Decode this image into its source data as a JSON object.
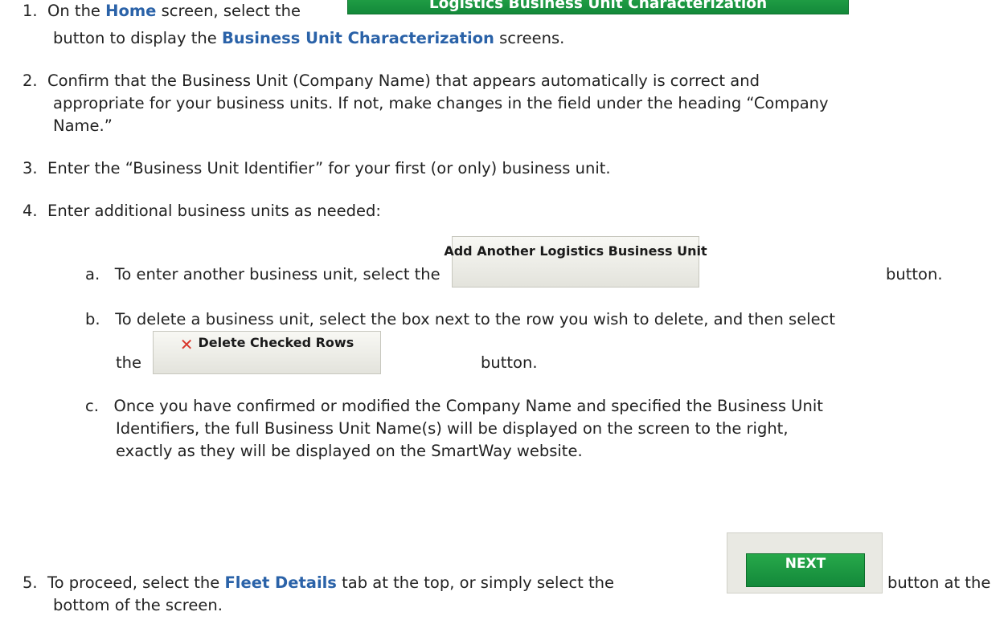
{
  "steps": {
    "s1": {
      "num": "1.",
      "t1": "On the",
      "home": "Home",
      "t2": "screen, select the",
      "button": "Logistics Business Unit Characterization",
      "t3": "button to display the",
      "buc": "Business Unit Characterization",
      "t4": "screens."
    },
    "s2": {
      "num": "2.",
      "l1": "Confirm that the Business Unit (Company Name) that appears automatically is correct and",
      "l2": "appropriate for your business units.  If not, make changes in the field under the heading “Company",
      "l3": "Name.”"
    },
    "s3": {
      "num": "3.",
      "l1": "Enter the “Business Unit Identifier” for your first (or only) business unit."
    },
    "s4": {
      "num": "4.",
      "l1": "Enter additional business units as needed:",
      "a": {
        "letter": "a.",
        "t1": "To enter another business unit, select the",
        "button": "Add Another Logistics Business Unit",
        "t2": "button."
      },
      "b": {
        "letter": "b.",
        "l1": "To delete a business unit, select the box next to the row you wish to delete, and then select",
        "the": "the",
        "button": "Delete Checked Rows",
        "icon": "red-x-icon",
        "t2": "button."
      },
      "c": {
        "letter": "c.",
        "l1": "Once you have confirmed or modified the Company Name and specified the Business Unit",
        "l2": "Identifiers, the full Business Unit Name(s) will be displayed on the screen to the right,",
        "l3": "exactly as they will be displayed on the SmartWay website."
      }
    },
    "s5": {
      "num": "5.",
      "t1": "To proceed, select the",
      "fleet": "Fleet Details",
      "t2": "tab at the top, or simply select the",
      "button": "NEXT",
      "t3": "button at the",
      "l2": "bottom of the screen."
    }
  },
  "colors": {
    "highlight": "#2a62a8",
    "green_button": "#1a9a40",
    "grey_button": "#ececE6",
    "delete_x": "#d9362b"
  }
}
